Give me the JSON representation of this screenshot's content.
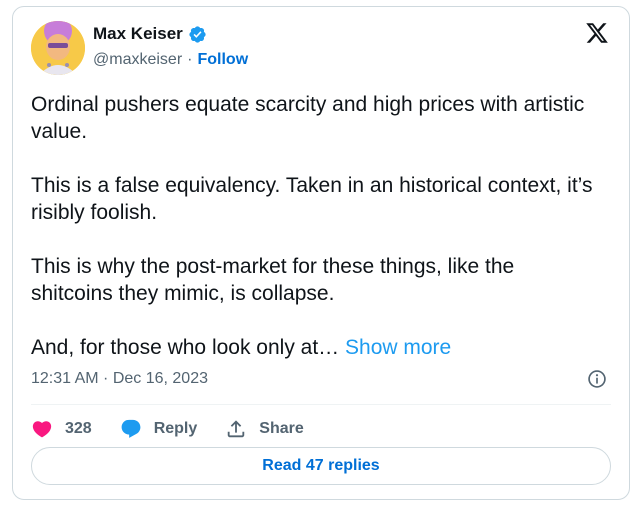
{
  "author": {
    "name": "Max Keiser",
    "handle": "@maxkeiser",
    "separator": "·",
    "follow_label": "Follow",
    "verified": true,
    "verified_color": "#1d9bf0"
  },
  "tweet": {
    "paragraphs": [
      "Ordinal pushers equate scarcity and high prices with artistic value.",
      "This is a false equivalency. Taken in an historical context, it’s risibly foolish.",
      "This is why the post-market for these things, like the shitcoins they mimic, is collapse."
    ],
    "truncated_text": "And, for those who look only at…",
    "show_more_label": "Show more",
    "timestamp": "12:31 AM · Dec 16, 2023"
  },
  "actions": {
    "like_count": "328",
    "like_color": "#f91880",
    "reply_label": "Reply",
    "reply_color": "#1d9bf0",
    "share_label": "Share"
  },
  "read_replies_label": "Read 47 replies",
  "icons": {
    "brand": "x-logo-icon",
    "info": "info-icon",
    "like": "heart-icon",
    "reply": "reply-bubble-icon",
    "share": "share-upload-icon",
    "verified": "verified-badge-icon"
  }
}
